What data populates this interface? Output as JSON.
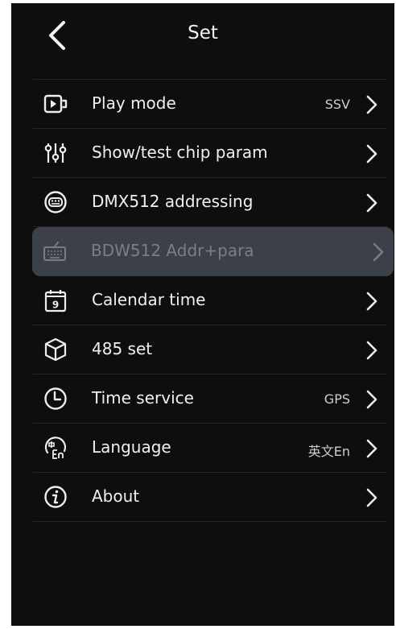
{
  "header": {
    "title": "Set"
  },
  "menu": {
    "items": [
      {
        "label": "Play mode",
        "value": "SSV",
        "icon": "play-mode-icon",
        "enabled": true
      },
      {
        "label": "Show/test chip param",
        "value": "",
        "icon": "sliders-icon",
        "enabled": true
      },
      {
        "label": "DMX512 addressing",
        "value": "",
        "icon": "dmx-connector-icon",
        "enabled": true
      },
      {
        "label": "BDW512 Addr+para",
        "value": "",
        "icon": "keyboard-icon",
        "enabled": false
      },
      {
        "label": "Calendar time",
        "value": "",
        "icon": "calendar-icon",
        "enabled": true
      },
      {
        "label": "485 set",
        "value": "",
        "icon": "cube-icon",
        "enabled": true
      },
      {
        "label": "Time service",
        "value": "GPS",
        "icon": "clock-icon",
        "enabled": true
      },
      {
        "label": "Language",
        "value": "英文En",
        "icon": "language-icon",
        "enabled": true
      },
      {
        "label": "About",
        "value": "",
        "icon": "info-icon",
        "enabled": true
      }
    ]
  },
  "calendar_icon_text": "9",
  "colors": {
    "background": "#0e0e0e",
    "text": "#f0f0f0",
    "disabled_row": "#3c404a",
    "divider": "#262626"
  }
}
